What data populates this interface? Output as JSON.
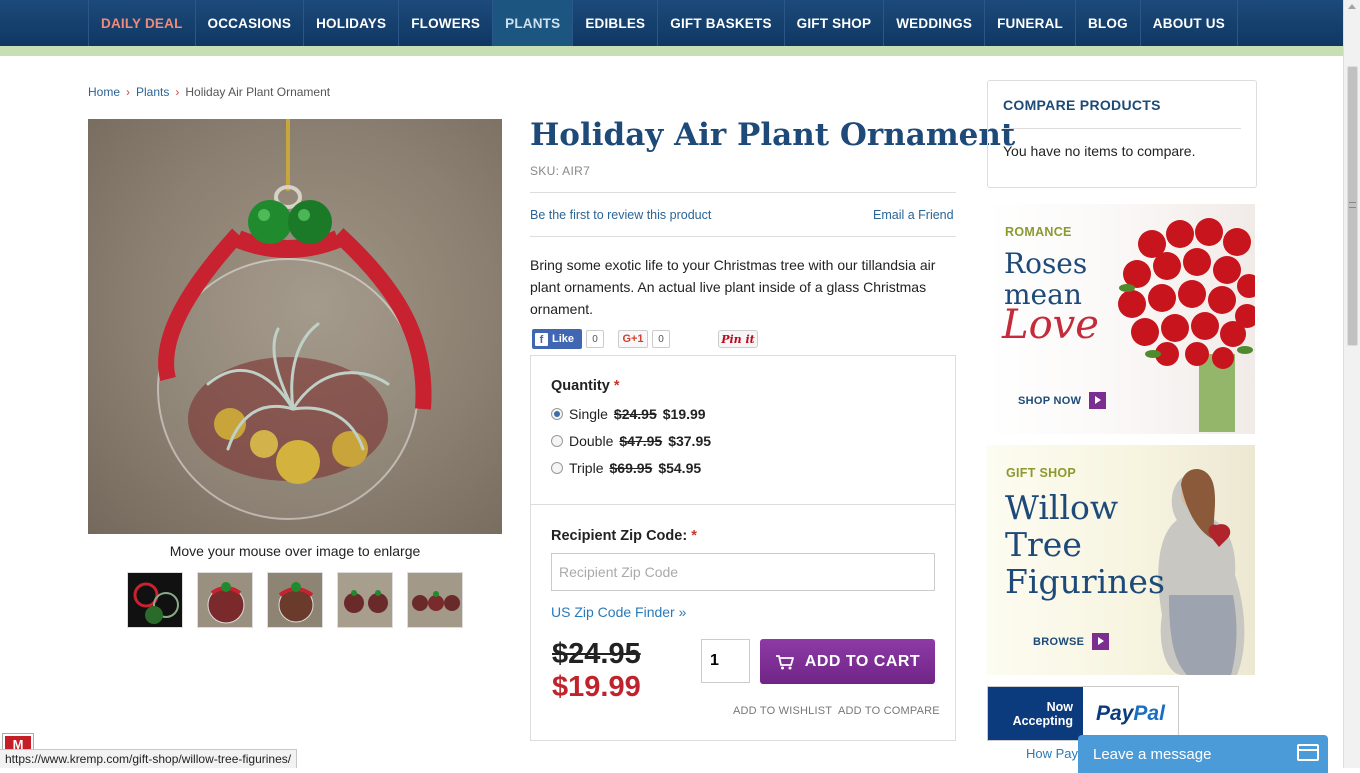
{
  "nav": {
    "items": [
      {
        "label": "DAILY DEAL",
        "name": "nav-daily-deal"
      },
      {
        "label": "OCCASIONS",
        "name": "nav-occasions"
      },
      {
        "label": "HOLIDAYS",
        "name": "nav-holidays"
      },
      {
        "label": "FLOWERS",
        "name": "nav-flowers"
      },
      {
        "label": "PLANTS",
        "name": "nav-plants"
      },
      {
        "label": "EDIBLES",
        "name": "nav-edibles"
      },
      {
        "label": "GIFT BASKETS",
        "name": "nav-gift-baskets"
      },
      {
        "label": "GIFT SHOP",
        "name": "nav-gift-shop"
      },
      {
        "label": "WEDDINGS",
        "name": "nav-weddings"
      },
      {
        "label": "FUNERAL",
        "name": "nav-funeral"
      },
      {
        "label": "BLOG",
        "name": "nav-blog"
      },
      {
        "label": "ABOUT US",
        "name": "nav-about-us"
      }
    ],
    "deal_color": "#f08a7a",
    "bar_color": "#0f3763",
    "active_item": "PLANTS"
  },
  "breadcrumb": {
    "home": "Home",
    "category": "Plants",
    "current": "Holiday Air Plant Ornament",
    "separator_icon": "chevron-right-icon"
  },
  "product": {
    "title": "Holiday Air Plant Ornament",
    "sku": "SKU: AIR7",
    "review_link": "Be the first to review this product",
    "email_link": "Email a Friend",
    "description": "Bring some exotic life to your Christmas tree with our tillandsia air plant ornaments. An actual live plant inside of a glass Christmas ornament.",
    "enlarge_note": "Move your mouse over image to enlarge",
    "thumbnail_count": 5
  },
  "social": {
    "fb_label": "Like",
    "fb_count": "0",
    "gplus_label": "G+1",
    "gplus_count": "0",
    "pin_label": "Pin it"
  },
  "options": {
    "quantity_label": "Quantity",
    "required_mark": "*",
    "choices": [
      {
        "name": "Single",
        "old": "$24.95",
        "new": "$19.99",
        "checked": true
      },
      {
        "name": "Double",
        "old": "$47.95",
        "new": "$37.95",
        "checked": false
      },
      {
        "name": "Triple",
        "old": "$69.95",
        "new": "$54.95",
        "checked": false
      }
    ],
    "zip_label": "Recipient Zip Code:",
    "zip_placeholder": "Recipient Zip Code",
    "zip_value": "",
    "zip_finder": "US Zip Code Finder »"
  },
  "purchase": {
    "old_price": "$24.95",
    "new_price": "$19.99",
    "qty_value": "1",
    "add_to_cart": "ADD TO CART",
    "cart_icon": "cart-icon",
    "wishlist": "ADD TO WISHLIST",
    "compare": "ADD TO COMPARE",
    "price_color": "#c0232c",
    "button_color": "#7c2d90"
  },
  "sidebar": {
    "compare_title": "COMPARE PRODUCTS",
    "compare_text": "You have no items to compare.",
    "promo1": {
      "kicker": "ROMANCE",
      "headline_1": "Roses",
      "headline_2": "mean",
      "script": "Love",
      "cta": "SHOP NOW"
    },
    "promo2": {
      "kicker": "GIFT SHOP",
      "headline_1": "Willow",
      "headline_2": "Tree",
      "headline_3": "Figurines",
      "cta": "BROWSE"
    },
    "paypal": {
      "accept_1": "Now",
      "accept_2": "Accepting",
      "brand_1": "Pay",
      "brand_2": "Pal",
      "how_link": "How PayPal Works"
    }
  },
  "chat": {
    "label": "Leave a message",
    "icon": "chat-window-icon"
  },
  "badge": {
    "mcafee_label": "M"
  },
  "status_bar": {
    "url": "https://www.kremp.com/gift-shop/willow-tree-figurines/"
  }
}
